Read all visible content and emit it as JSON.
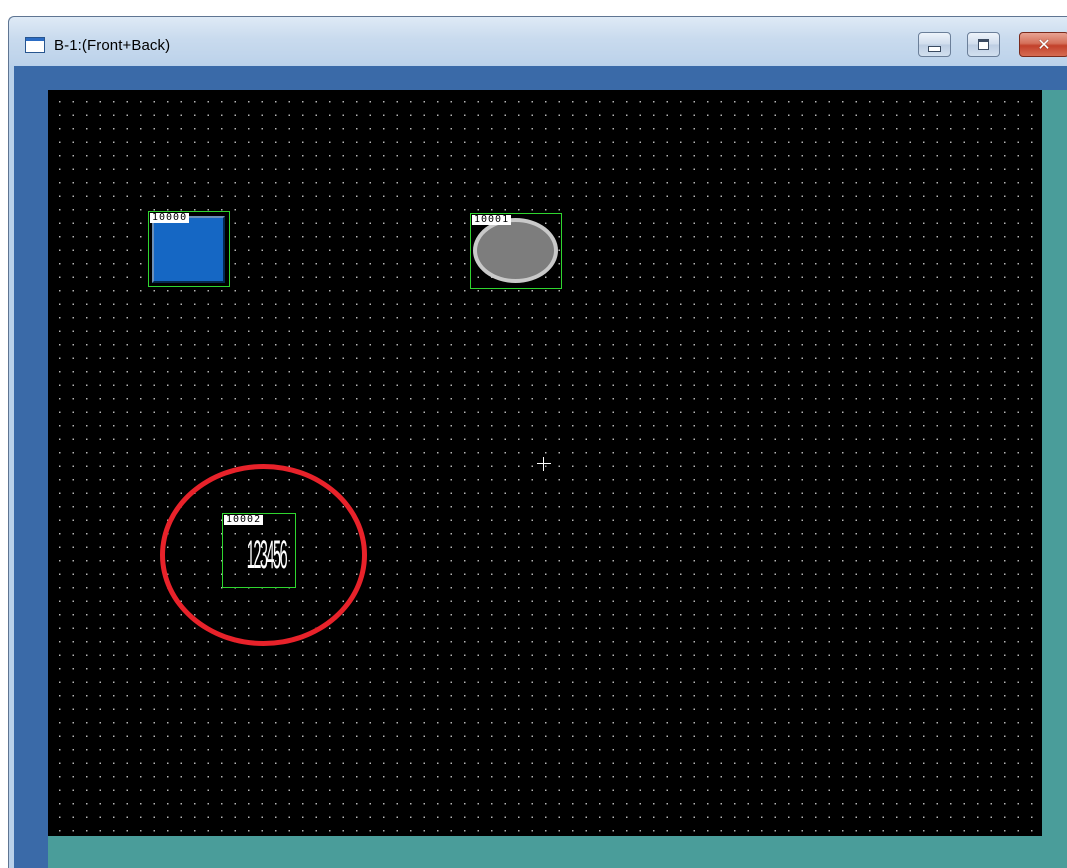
{
  "window": {
    "title": "B-1:(Front+Back)",
    "buttons": {
      "minimize": "minimize",
      "maximize": "maximize",
      "close": "close"
    }
  },
  "colors": {
    "canvas_background": "#000000",
    "grid_dots": "#b8b8b8",
    "object_frame": "#2fd52f",
    "switch_fill": "#1567c4",
    "lamp_fill": "#7d7d7d",
    "annotation_ring": "#e8222a",
    "frame_blue": "#3a6aa8",
    "frame_teal": "#4a9d9a"
  },
  "screen_objects": [
    {
      "id": "10000",
      "kind": "switch"
    },
    {
      "id": "10001",
      "kind": "lamp"
    },
    {
      "id": "10002",
      "kind": "numeric-display",
      "value": "123456"
    }
  ],
  "icons": {
    "window_icon": "window-icon",
    "crosshair": "crosshair-cursor-icon"
  }
}
